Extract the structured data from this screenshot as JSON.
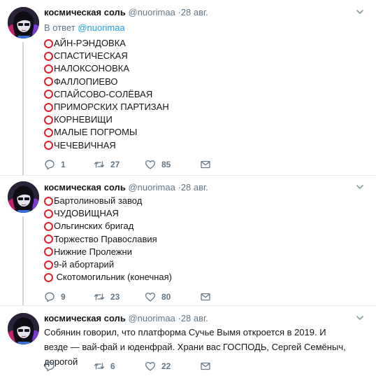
{
  "colors": {
    "ring": "#e0202c",
    "link": "#1da1f2",
    "muted": "#657786",
    "text": "#14171a"
  },
  "icons": {
    "reply": "reply-icon",
    "retweet": "retweet-icon",
    "like": "heart-icon",
    "dm": "envelope-icon",
    "caret": "chevron-down-icon"
  },
  "tweets": [
    {
      "author": {
        "name": "космическая соль",
        "handle": "@nuorimaa",
        "separator": "·",
        "date": "28 авг."
      },
      "reply_to": {
        "prefix": "В ответ",
        "handle": "@nuorimaa"
      },
      "items": [
        "АЙН-РЭНДОВКА",
        "СПАСТИЧЕСКАЯ",
        "НАЛОКСОНОВКА",
        "ФАЛЛОПИЕВО",
        "СПАЙСОВО-СОЛЁВАЯ",
        "ПРИМОРСКИХ ПАРТИЗАН",
        "КОРНЕВИЩИ",
        "МАЛЫЕ ПОГРОМЫ",
        "ЧЕЧЕВИЧНАЯ"
      ],
      "stats": {
        "replies": "1",
        "retweets": "27",
        "likes": "85"
      }
    },
    {
      "author": {
        "name": "космическая соль",
        "handle": "@nuorimaa",
        "separator": "·",
        "date": "28 авг."
      },
      "items": [
        "Бартолиновый завод",
        "ЧУДОВИЩНАЯ",
        "Ольгинских бригад",
        "Торжество Православия",
        "Нижние Пролежни",
        "9-й абортарий",
        " Скотомогильник (конечная)"
      ],
      "stats": {
        "replies": "9",
        "retweets": "23",
        "likes": "80"
      }
    },
    {
      "author": {
        "name": "космическая соль",
        "handle": "@nuorimaa",
        "separator": "·",
        "date": "28 авг."
      },
      "text": "Собянин говорил, что платформа Сучье Вымя откроется в 2019. И везде — вай-фай и юденфрай. Храни вас ГОСПОДЬ, Сергей Семёныч, дорогой",
      "stats": {
        "replies": "",
        "retweets": "6",
        "likes": "22"
      }
    }
  ]
}
